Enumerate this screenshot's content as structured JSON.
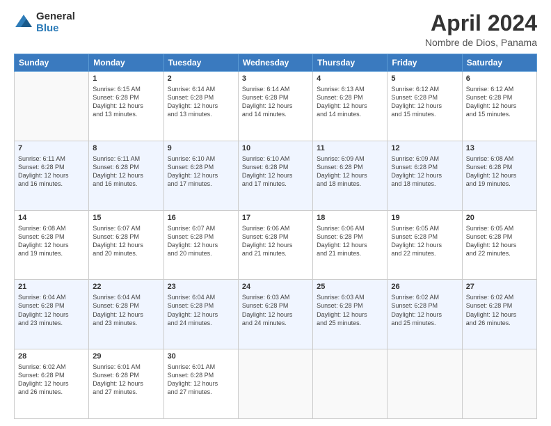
{
  "logo": {
    "general": "General",
    "blue": "Blue"
  },
  "title": "April 2024",
  "subtitle": "Nombre de Dios, Panama",
  "days_of_week": [
    "Sunday",
    "Monday",
    "Tuesday",
    "Wednesday",
    "Thursday",
    "Friday",
    "Saturday"
  ],
  "weeks": [
    [
      {
        "day": "",
        "info": ""
      },
      {
        "day": "1",
        "info": "Sunrise: 6:15 AM\nSunset: 6:28 PM\nDaylight: 12 hours\nand 13 minutes."
      },
      {
        "day": "2",
        "info": "Sunrise: 6:14 AM\nSunset: 6:28 PM\nDaylight: 12 hours\nand 13 minutes."
      },
      {
        "day": "3",
        "info": "Sunrise: 6:14 AM\nSunset: 6:28 PM\nDaylight: 12 hours\nand 14 minutes."
      },
      {
        "day": "4",
        "info": "Sunrise: 6:13 AM\nSunset: 6:28 PM\nDaylight: 12 hours\nand 14 minutes."
      },
      {
        "day": "5",
        "info": "Sunrise: 6:12 AM\nSunset: 6:28 PM\nDaylight: 12 hours\nand 15 minutes."
      },
      {
        "day": "6",
        "info": "Sunrise: 6:12 AM\nSunset: 6:28 PM\nDaylight: 12 hours\nand 15 minutes."
      }
    ],
    [
      {
        "day": "7",
        "info": "Sunrise: 6:11 AM\nSunset: 6:28 PM\nDaylight: 12 hours\nand 16 minutes."
      },
      {
        "day": "8",
        "info": "Sunrise: 6:11 AM\nSunset: 6:28 PM\nDaylight: 12 hours\nand 16 minutes."
      },
      {
        "day": "9",
        "info": "Sunrise: 6:10 AM\nSunset: 6:28 PM\nDaylight: 12 hours\nand 17 minutes."
      },
      {
        "day": "10",
        "info": "Sunrise: 6:10 AM\nSunset: 6:28 PM\nDaylight: 12 hours\nand 17 minutes."
      },
      {
        "day": "11",
        "info": "Sunrise: 6:09 AM\nSunset: 6:28 PM\nDaylight: 12 hours\nand 18 minutes."
      },
      {
        "day": "12",
        "info": "Sunrise: 6:09 AM\nSunset: 6:28 PM\nDaylight: 12 hours\nand 18 minutes."
      },
      {
        "day": "13",
        "info": "Sunrise: 6:08 AM\nSunset: 6:28 PM\nDaylight: 12 hours\nand 19 minutes."
      }
    ],
    [
      {
        "day": "14",
        "info": "Sunrise: 6:08 AM\nSunset: 6:28 PM\nDaylight: 12 hours\nand 19 minutes."
      },
      {
        "day": "15",
        "info": "Sunrise: 6:07 AM\nSunset: 6:28 PM\nDaylight: 12 hours\nand 20 minutes."
      },
      {
        "day": "16",
        "info": "Sunrise: 6:07 AM\nSunset: 6:28 PM\nDaylight: 12 hours\nand 20 minutes."
      },
      {
        "day": "17",
        "info": "Sunrise: 6:06 AM\nSunset: 6:28 PM\nDaylight: 12 hours\nand 21 minutes."
      },
      {
        "day": "18",
        "info": "Sunrise: 6:06 AM\nSunset: 6:28 PM\nDaylight: 12 hours\nand 21 minutes."
      },
      {
        "day": "19",
        "info": "Sunrise: 6:05 AM\nSunset: 6:28 PM\nDaylight: 12 hours\nand 22 minutes."
      },
      {
        "day": "20",
        "info": "Sunrise: 6:05 AM\nSunset: 6:28 PM\nDaylight: 12 hours\nand 22 minutes."
      }
    ],
    [
      {
        "day": "21",
        "info": "Sunrise: 6:04 AM\nSunset: 6:28 PM\nDaylight: 12 hours\nand 23 minutes."
      },
      {
        "day": "22",
        "info": "Sunrise: 6:04 AM\nSunset: 6:28 PM\nDaylight: 12 hours\nand 23 minutes."
      },
      {
        "day": "23",
        "info": "Sunrise: 6:04 AM\nSunset: 6:28 PM\nDaylight: 12 hours\nand 24 minutes."
      },
      {
        "day": "24",
        "info": "Sunrise: 6:03 AM\nSunset: 6:28 PM\nDaylight: 12 hours\nand 24 minutes."
      },
      {
        "day": "25",
        "info": "Sunrise: 6:03 AM\nSunset: 6:28 PM\nDaylight: 12 hours\nand 25 minutes."
      },
      {
        "day": "26",
        "info": "Sunrise: 6:02 AM\nSunset: 6:28 PM\nDaylight: 12 hours\nand 25 minutes."
      },
      {
        "day": "27",
        "info": "Sunrise: 6:02 AM\nSunset: 6:28 PM\nDaylight: 12 hours\nand 26 minutes."
      }
    ],
    [
      {
        "day": "28",
        "info": "Sunrise: 6:02 AM\nSunset: 6:28 PM\nDaylight: 12 hours\nand 26 minutes."
      },
      {
        "day": "29",
        "info": "Sunrise: 6:01 AM\nSunset: 6:28 PM\nDaylight: 12 hours\nand 27 minutes."
      },
      {
        "day": "30",
        "info": "Sunrise: 6:01 AM\nSunset: 6:28 PM\nDaylight: 12 hours\nand 27 minutes."
      },
      {
        "day": "",
        "info": ""
      },
      {
        "day": "",
        "info": ""
      },
      {
        "day": "",
        "info": ""
      },
      {
        "day": "",
        "info": ""
      }
    ]
  ]
}
